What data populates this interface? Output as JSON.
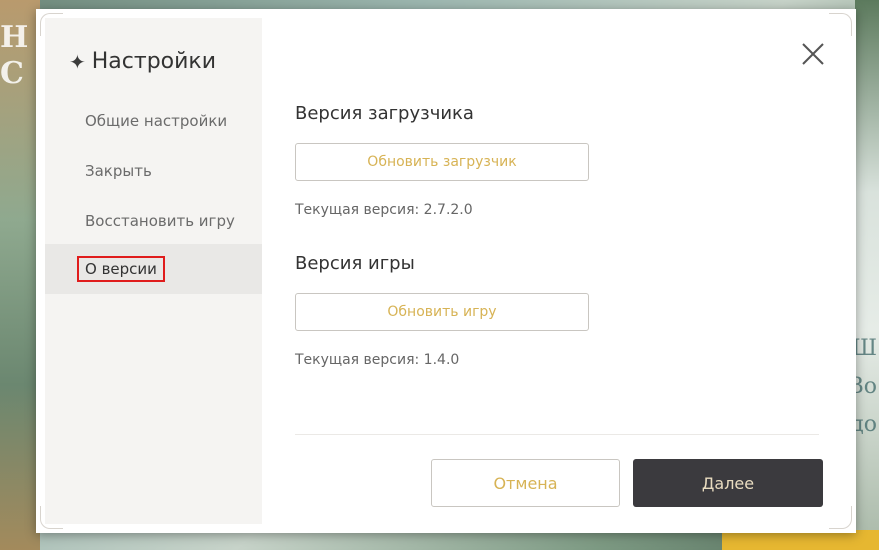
{
  "background": {
    "left_letters": "Н\nС",
    "right_text_lines": [
      "Ш",
      "Bo",
      "до"
    ]
  },
  "sidebar": {
    "title": "Настройки",
    "title_icon": "star-icon",
    "items": [
      {
        "label": "Общие настройки",
        "active": false
      },
      {
        "label": "Закрыть",
        "active": false
      },
      {
        "label": "Восстановить игру",
        "active": false
      },
      {
        "label": "О версии",
        "active": true
      }
    ]
  },
  "main": {
    "launcher": {
      "title": "Версия загрузчика",
      "button_label": "Обновить загрузчик",
      "current_version": "Текущая версия: 2.7.2.0"
    },
    "game": {
      "title": "Версия игры",
      "button_label": "Обновить игру",
      "current_version": "Текущая версия: 1.4.0"
    }
  },
  "footer": {
    "cancel_label": "Отмена",
    "next_label": "Далее"
  },
  "colors": {
    "accent_gold": "#d7b355",
    "dark_button": "#3b3a3e",
    "highlight_border": "#e01c1c"
  }
}
